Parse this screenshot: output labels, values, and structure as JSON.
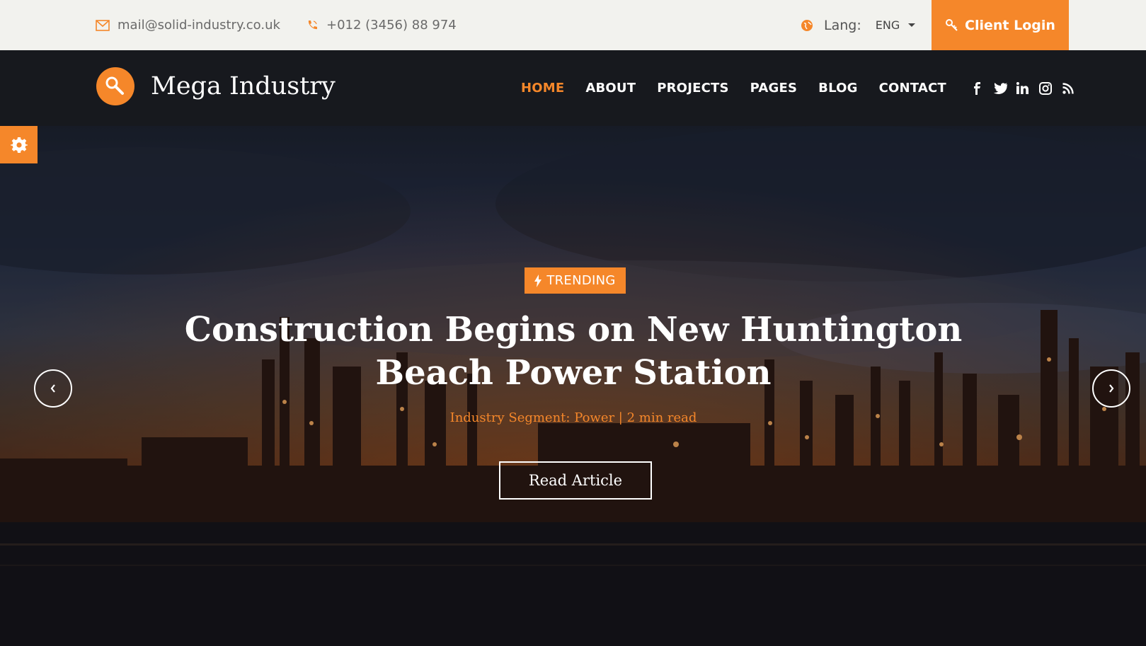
{
  "topbar": {
    "email": "mail@solid-industry.co.uk",
    "phone": "+012 (3456) 88 974",
    "lang_label": "Lang:",
    "lang_value": "ENG",
    "client_login": "Client Login"
  },
  "header": {
    "brand": "Mega Industry",
    "nav": [
      "HOME",
      "ABOUT",
      "PROJECTS",
      "PAGES",
      "BLOG",
      "CONTACT"
    ],
    "active_nav": "HOME",
    "social": [
      "facebook-icon",
      "twitter-icon",
      "linkedin-icon",
      "instagram-icon",
      "rss-icon"
    ]
  },
  "hero": {
    "badge": "TRENDING",
    "headline_line1": "Construction Begins on New Huntington",
    "headline_line2": "Beach Power Station",
    "meta": "Industry Segment: Power | 2 min read",
    "cta": "Read Article"
  },
  "colors": {
    "accent": "#f5872a",
    "topbar_bg": "#f2f2ee",
    "header_bg": "#17191e"
  }
}
